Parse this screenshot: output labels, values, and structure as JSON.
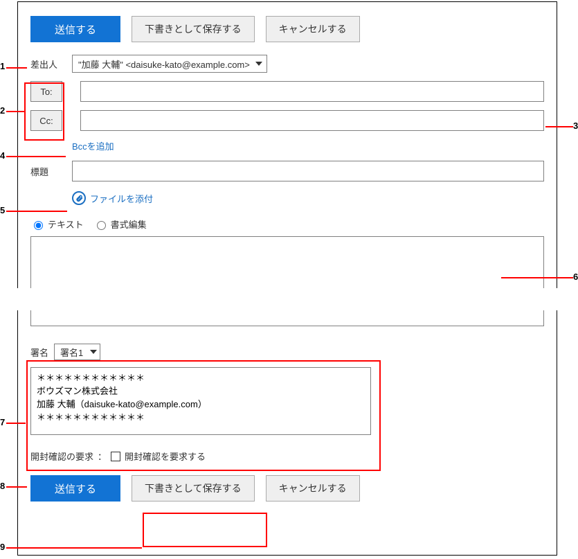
{
  "actions": {
    "send": "送信する",
    "save_draft": "下書きとして保存する",
    "cancel": "キャンセルする"
  },
  "from": {
    "label": "差出人",
    "value": "\"加藤 大輔\" <daisuke-kato@example.com>"
  },
  "recipients": {
    "to_label": "To:",
    "to_value": "",
    "cc_label": "Cc:",
    "cc_value": "",
    "add_bcc": "Bccを追加"
  },
  "subject": {
    "label": "標題",
    "value": ""
  },
  "attach": {
    "label": "ファイルを添付"
  },
  "format": {
    "text": "テキスト",
    "rich": "書式編集",
    "selected": "text"
  },
  "body": "",
  "signature": {
    "label": "署名",
    "selected": "署名1",
    "text": "＊＊＊＊＊＊＊＊＊＊＊＊\nボウズマン株式会社\n加藤 大輔（daisuke-kato@example.com）\n＊＊＊＊＊＊＊＊＊＊＊＊"
  },
  "receipt": {
    "label": "開封確認の要求",
    "sep": "：",
    "checkbox_label": "開封確認を要求する",
    "checked": false
  },
  "annotations": {
    "n1": "1",
    "n2": "2",
    "n3": "3",
    "n4": "4",
    "n5": "5",
    "n6": "6",
    "n7": "7",
    "n8": "8",
    "n9": "9"
  }
}
